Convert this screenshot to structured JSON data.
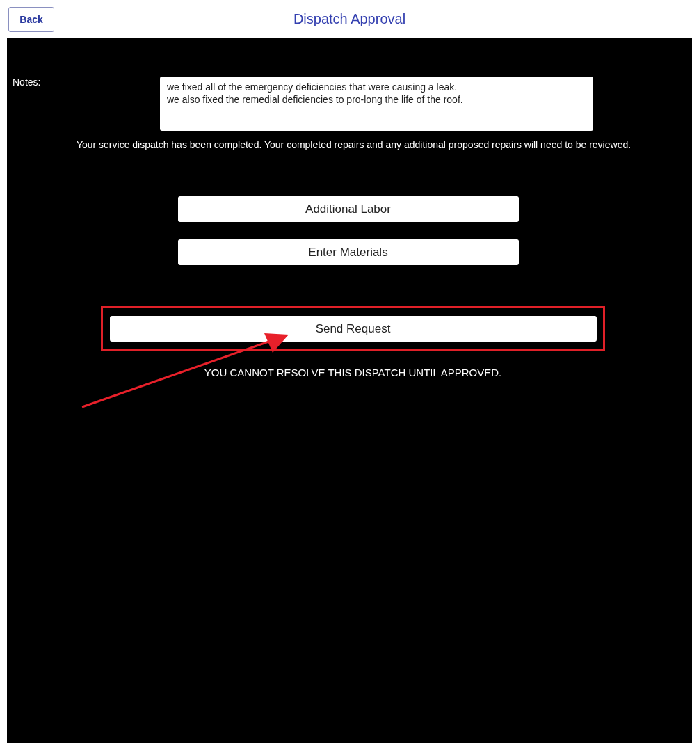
{
  "header": {
    "back_button": "Back",
    "title": "Dispatch Approval"
  },
  "notes": {
    "label": "Notes:",
    "value": "we fixed all of the emergency deficiencies that were causing a leak.\nwe also fixed the remedial deficiencies to pro-long the life of the roof."
  },
  "message": "Your service dispatch has been completed. Your completed repairs and any additional proposed repairs will need to be reviewed.",
  "buttons": [
    "Additional Labor",
    "Enter Materials"
  ],
  "send_button": "Send Request",
  "warning": "YOU CANNOT RESOLVE THIS DISPATCH UNTIL APPROVED."
}
